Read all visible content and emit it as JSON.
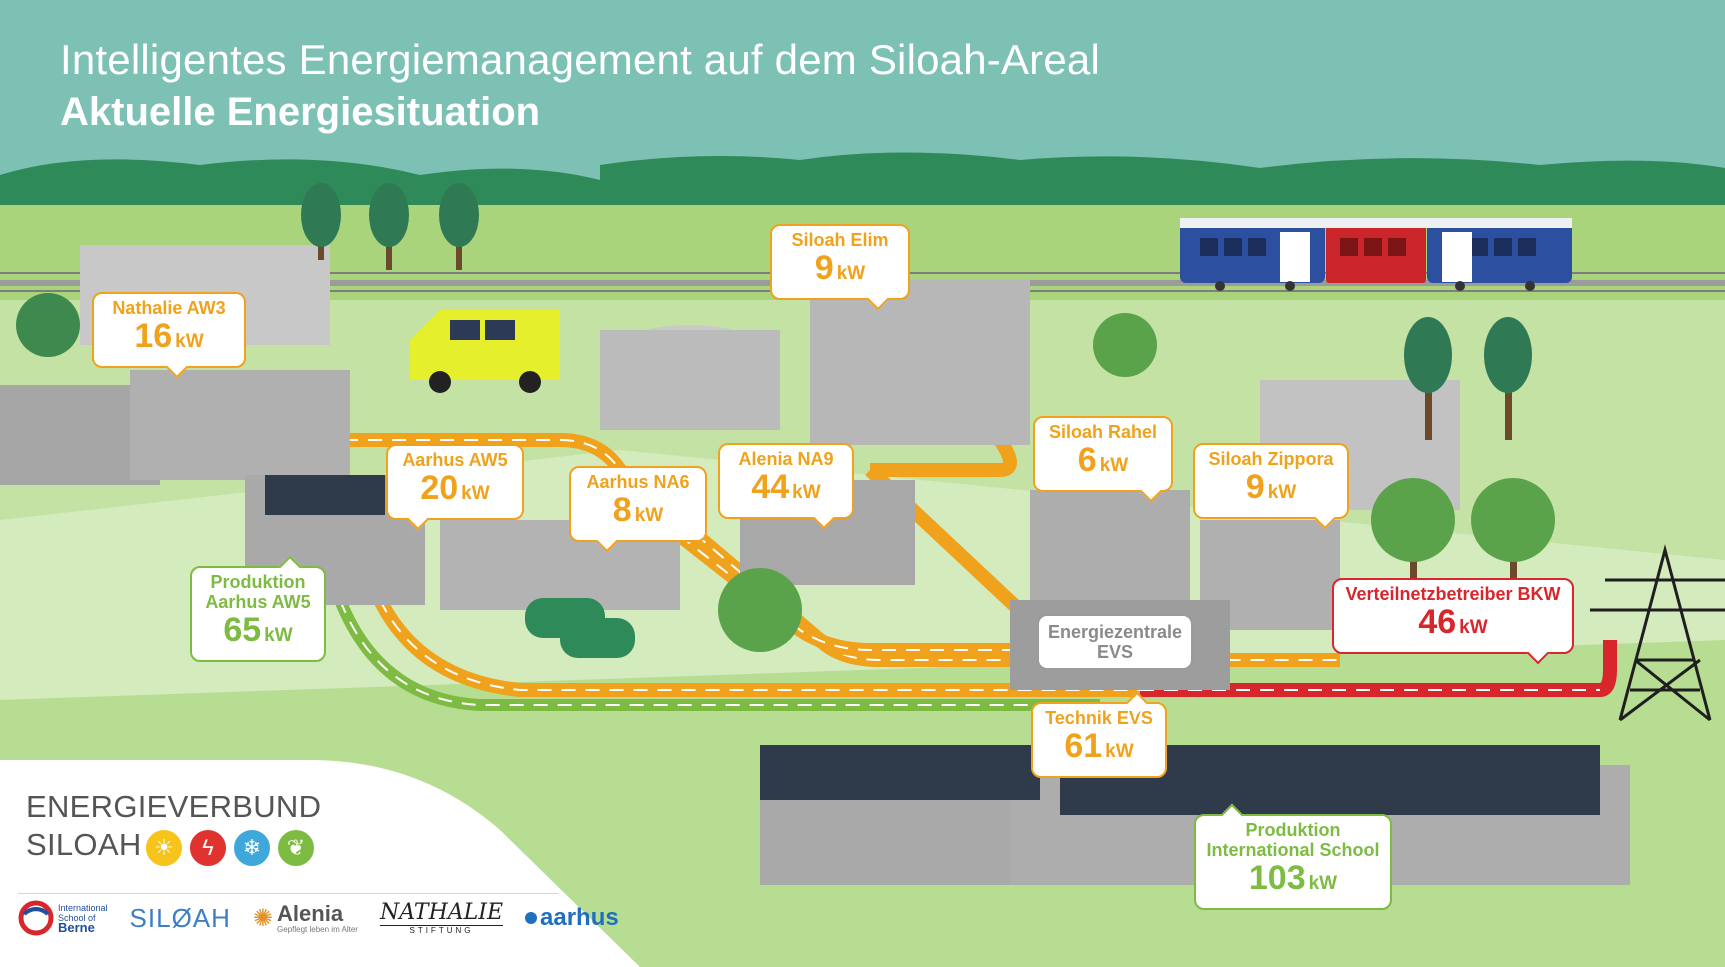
{
  "header": {
    "title": "Intelligentes Energiemanagement auf dem Siloah-Areal",
    "subtitle": "Aktuelle Energiesituation"
  },
  "colors": {
    "sky": "#7dc1b5",
    "consumption": "#f0a21c",
    "production": "#7dbb42",
    "grid": "#d9262c",
    "central": "#9a9a9a"
  },
  "unit": "kW",
  "consumers": [
    {
      "name": "Nathalie AW3",
      "value": "16"
    },
    {
      "name": "Aarhus AW5",
      "value": "20"
    },
    {
      "name": "Aarhus NA6",
      "value": "8"
    },
    {
      "name": "Alenia NA9",
      "value": "44"
    },
    {
      "name": "Siloah Elim",
      "value": "9"
    },
    {
      "name": "Siloah Rahel",
      "value": "6"
    },
    {
      "name": "Siloah Zippora",
      "value": "9"
    },
    {
      "name": "Technik EVS",
      "value": "61"
    }
  ],
  "producers": [
    {
      "name_line1": "Produktion",
      "name_line2": "Aarhus AW5",
      "value": "65"
    },
    {
      "name_line1": "Produktion",
      "name_line2": "International School",
      "value": "103"
    }
  ],
  "grid_operator": {
    "name": "Verteilnetzbetreiber BKW",
    "value": "46"
  },
  "central": {
    "line1": "Energiezentrale",
    "line2": "EVS"
  },
  "brand": {
    "line1": "ENERGIEVERBUND",
    "line2": "SILOAH",
    "icons": [
      "sun-icon",
      "lightning-icon",
      "snowflake-icon",
      "leaf-icon"
    ]
  },
  "partners": {
    "school_line1": "International",
    "school_line2": "School of",
    "school_line3": "Berne",
    "siloah": "SILØAH",
    "alenia": "Alenia",
    "alenia_tagline": "Gepflegt leben im Alter",
    "nathalie": "NATHALIE",
    "nathalie_sub": "STIFTUNG",
    "aarhus": "aarhus"
  }
}
